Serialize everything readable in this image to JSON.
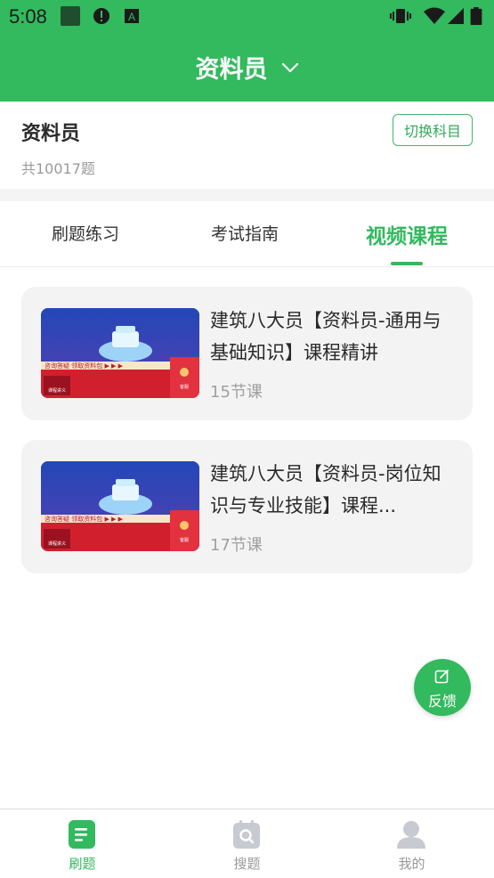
{
  "status_bar": {
    "time": "5:08"
  },
  "header": {
    "title": "资料员"
  },
  "subject": {
    "name": "资料员",
    "count": "共10017题",
    "switch_label": "切换科目"
  },
  "tabs": [
    {
      "label": "刷题练习",
      "active": false
    },
    {
      "label": "考试指南",
      "active": false
    },
    {
      "label": "视频课程",
      "active": true
    }
  ],
  "courses": [
    {
      "title": "建筑八大员【资料员-通用与基础知识】课程精讲",
      "lessons": "15节课"
    },
    {
      "title": "建筑八大员【资料员-岗位知识与专业技能】课程...",
      "lessons": "17节课"
    }
  ],
  "thumbnail": {
    "banner_text": "咨询答疑 领取资料包 ▶ ▶ ▶",
    "left_badge": "课程讲义",
    "right_badge": "客服"
  },
  "feedback": {
    "label": "反馈"
  },
  "bottom_nav": [
    {
      "label": "刷题",
      "icon": "document-icon",
      "active": true
    },
    {
      "label": "搜题",
      "icon": "search-calendar-icon",
      "active": false
    },
    {
      "label": "我的",
      "icon": "user-icon",
      "active": false
    }
  ],
  "colors": {
    "brand": "#33b95e",
    "card_bg": "#f3f3f3",
    "thumb_red": "#d21f2e",
    "thumb_blue": "#1d3a9a"
  }
}
